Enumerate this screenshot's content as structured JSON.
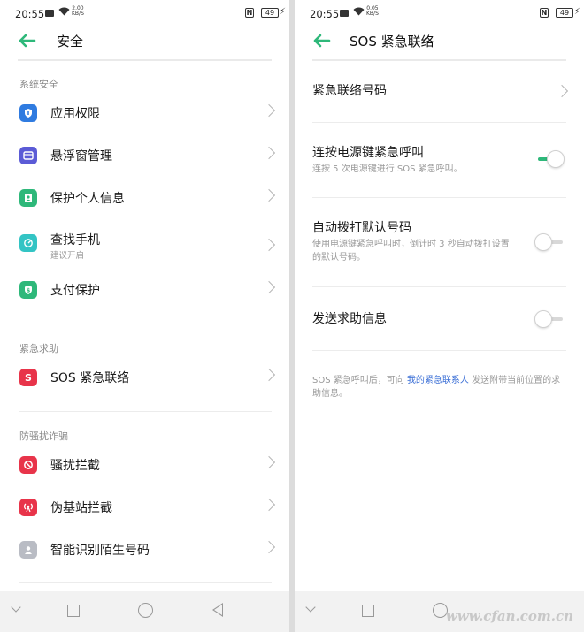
{
  "left": {
    "status": {
      "time": "20:55",
      "speed_top": "2.00",
      "speed_unit": "KB/S",
      "battery": "49"
    },
    "header": {
      "title": "安全"
    },
    "sections": [
      {
        "title": "系统安全",
        "items": [
          {
            "label": "应用权限",
            "icon": "shield-icon",
            "color": "#2f7be0"
          },
          {
            "label": "悬浮窗管理",
            "icon": "window-icon",
            "color": "#5b5bd6"
          },
          {
            "label": "保护个人信息",
            "icon": "person-lock-icon",
            "color": "#2eb87a"
          },
          {
            "label": "查找手机",
            "sub": "建议开启",
            "icon": "locate-icon",
            "color": "#33c4c4"
          },
          {
            "label": "支付保护",
            "icon": "pay-shield-icon",
            "color": "#2eb87a"
          }
        ]
      },
      {
        "title": "紧急求助",
        "items": [
          {
            "label": "SOS 紧急联络",
            "icon": "sos-icon",
            "glyph": "S",
            "color": "#e8344a"
          }
        ]
      },
      {
        "title": "防骚扰诈骗",
        "items": [
          {
            "label": "骚扰拦截",
            "icon": "block-icon",
            "color": "#e8344a"
          },
          {
            "label": "伪基站拦截",
            "icon": "antenna-icon",
            "color": "#e8344a"
          },
          {
            "label": "智能识别陌生号码",
            "icon": "contact-icon",
            "color": "#b9bcc4"
          }
        ]
      }
    ]
  },
  "right": {
    "status": {
      "time": "20:55",
      "speed_top": "0.05",
      "speed_unit": "KB/S",
      "battery": "49"
    },
    "header": {
      "title": "SOS 紧急联络"
    },
    "contacts_label": "紧急联络号码",
    "power_call": {
      "label": "连按电源键紧急呼叫",
      "desc": "连按 5 次电源键进行 SOS 紧急呼叫。",
      "on": true
    },
    "auto_dial": {
      "label": "自动拨打默认号码",
      "desc": "使用电源键紧急呼叫时，倒计时 3 秒自动拨打设置的默认号码。",
      "on": false
    },
    "send_help": {
      "label": "发送求助信息",
      "on": false
    },
    "note": {
      "before": "SOS 紧急呼叫后，可向 ",
      "link": "我的紧急联系人",
      "after": " 发送附带当前位置的求助信息。"
    }
  },
  "watermark": "www.cfan.com.cn"
}
